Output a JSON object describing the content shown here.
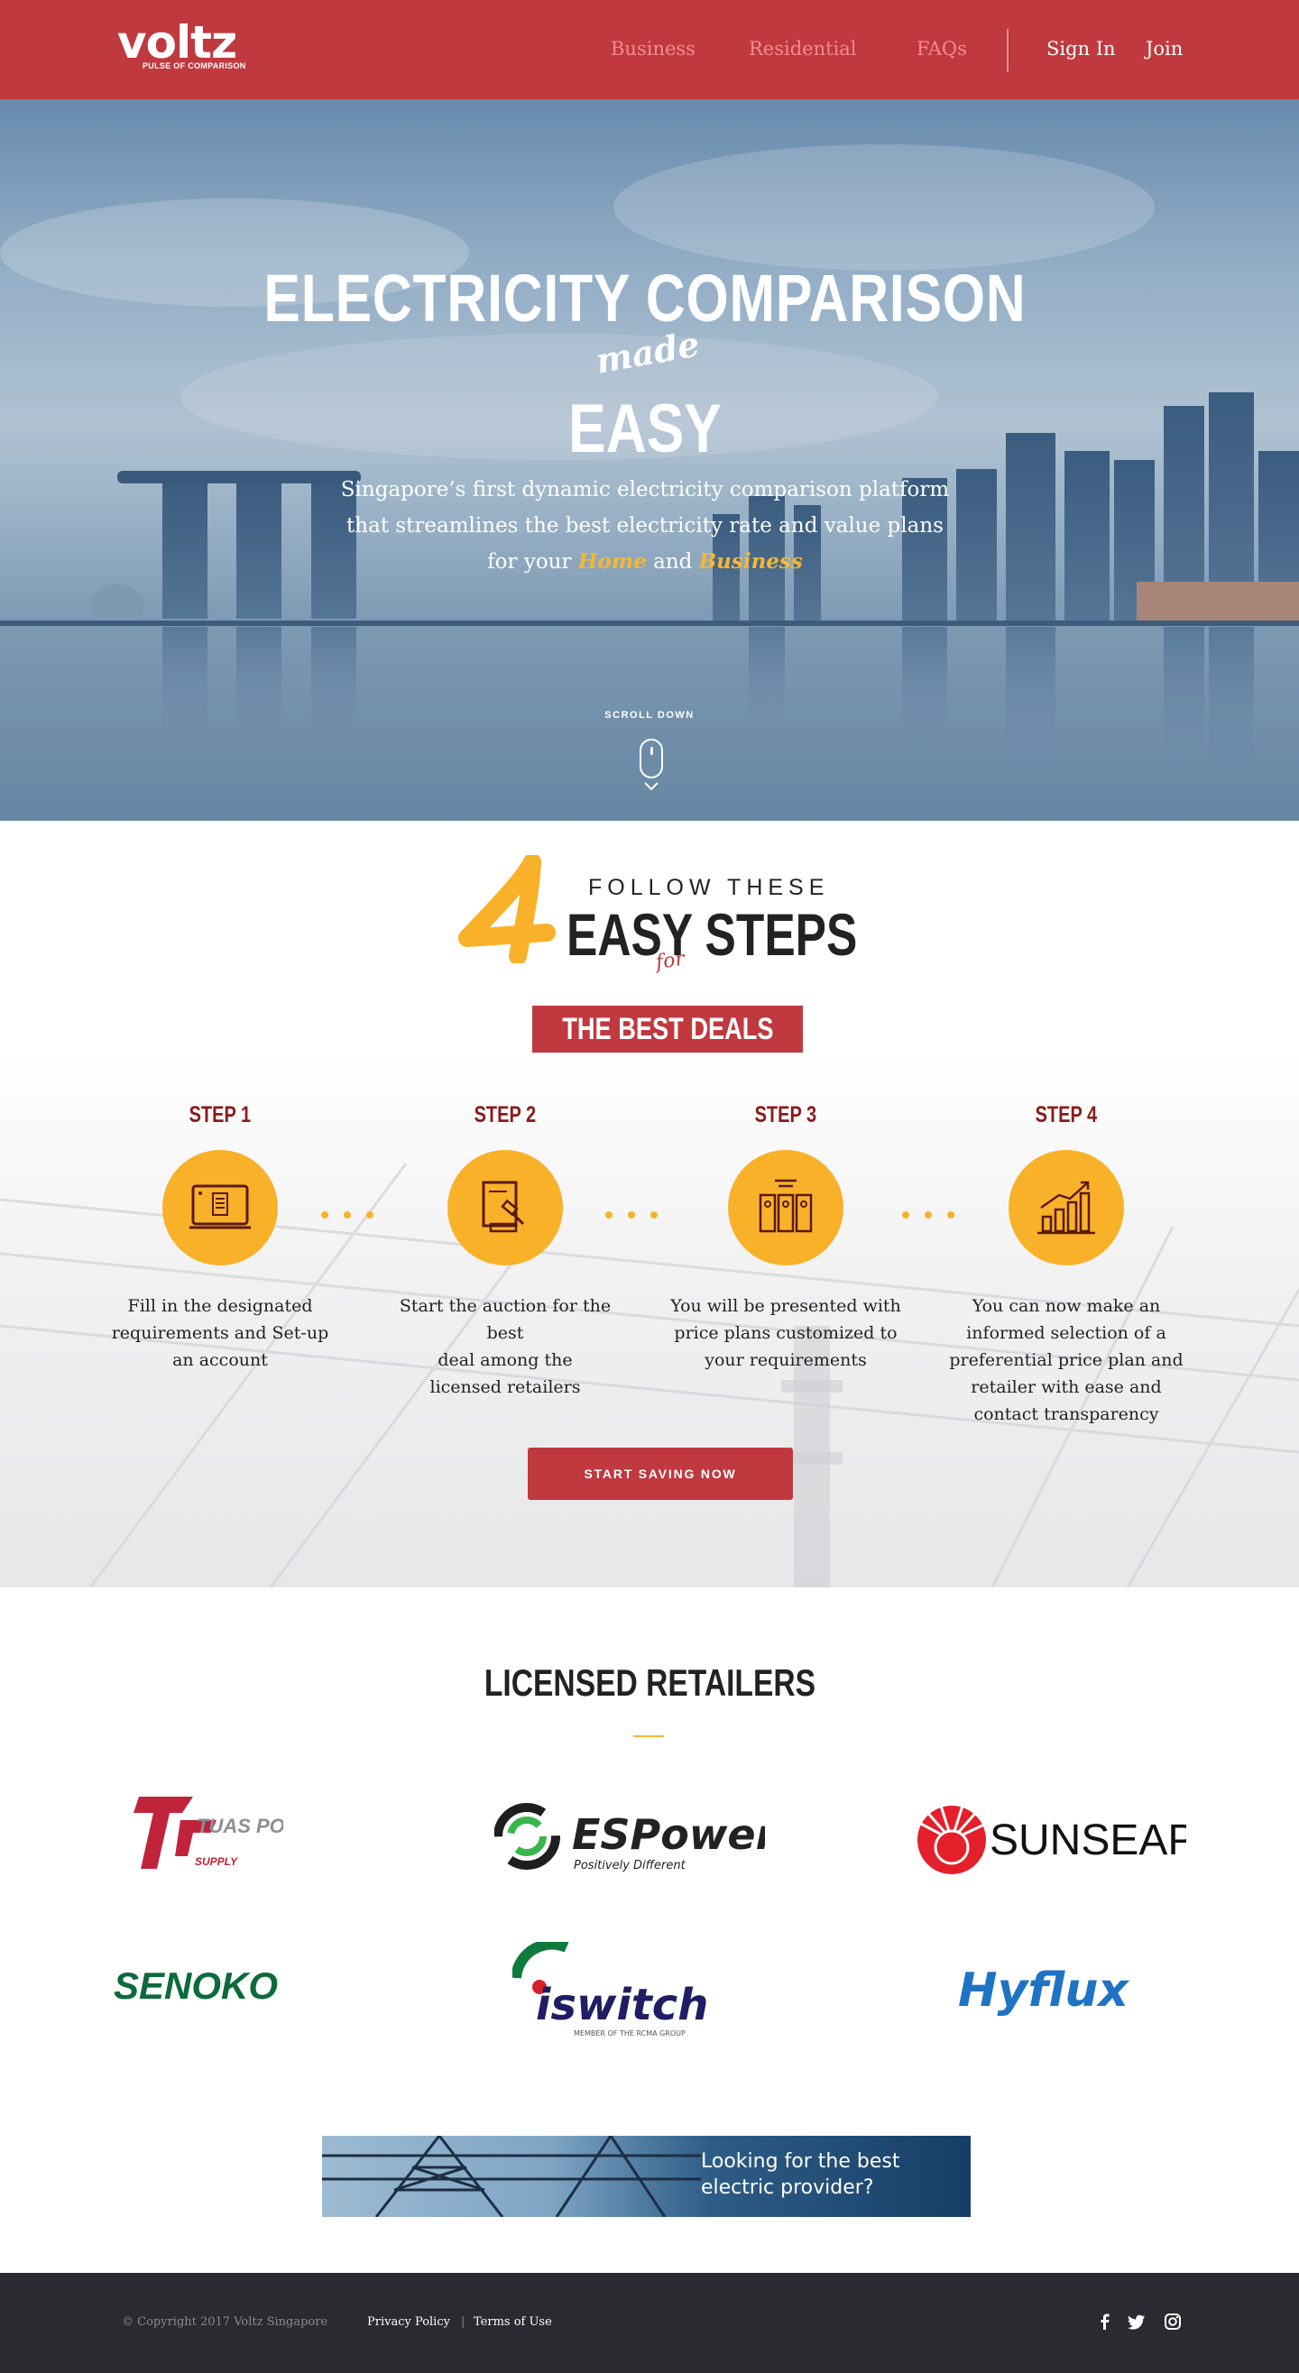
{
  "nav": {
    "logo_word": "voltz",
    "logo_tagline": "PULSE OF COMPARISON",
    "links": [
      {
        "label": "Business"
      },
      {
        "label": "Residential"
      },
      {
        "label": "FAQs"
      }
    ],
    "sign_in": "Sign In",
    "join": "Join"
  },
  "hero": {
    "title": "ELECTRICITY COMPARISON",
    "made": "made",
    "easy": "EASY",
    "subtitle_line1": "Singapore’s first dynamic electricity comparison platform",
    "subtitle_line2": "that streamlines the best electricity rate and value plans",
    "subtitle_prefix": "for your",
    "home": "Home",
    "and": "and",
    "business": "Business",
    "scroll_label": "SCROLL DOWN"
  },
  "steps_section": {
    "big_number": "4",
    "follow": "FOLLOW THESE",
    "easy_steps": "EASY STEPS",
    "for": "for",
    "best_deals": "THE BEST DEALS",
    "steps": [
      {
        "label": "STEP 1",
        "icon": "computer-form-icon",
        "text_lines": [
          "Fill in the designated",
          "requirements and Set-up",
          "an account"
        ]
      },
      {
        "label": "STEP 2",
        "icon": "auction-gavel-icon",
        "text_lines": [
          "Start the auction for the best",
          "deal among the",
          "licensed retailers"
        ]
      },
      {
        "label": "STEP 3",
        "icon": "price-plans-icon",
        "text_lines": [
          "You will be presented with",
          "price plans customized to",
          "your requirements"
        ]
      },
      {
        "label": "STEP 4",
        "icon": "growth-chart-icon",
        "text_lines": [
          "You can now make an",
          "informed selection of a",
          "preferential price plan and",
          "retailer with ease and",
          "contact transparency"
        ]
      }
    ],
    "cta": "START SAVING NOW"
  },
  "retailers": {
    "title": "LICENSED RETAILERS",
    "logos": [
      {
        "name": "TUAS POWER",
        "sub": "SUPPLY",
        "mark": "tuas-power-logo"
      },
      {
        "name": "ESPower",
        "sub": "Positively Different",
        "mark": "espower-logo"
      },
      {
        "name": "SUNSEAP",
        "mark": "sunseap-logo"
      },
      {
        "name": "SENOKO",
        "mark": "senoko-logo"
      },
      {
        "name": "iswitch",
        "sub": "MEMBER OF THE RCMA GROUP",
        "mark": "iswitch-logo"
      },
      {
        "name": "Hyflux",
        "mark": "hyflux-logo"
      }
    ],
    "banner_line1": "Looking for the best",
    "banner_line2": "electric provider?"
  },
  "footer": {
    "copyright": "© Copyright 2017 Voltz Singapore",
    "privacy": "Privacy Policy",
    "separator": "|",
    "terms": "Terms of Use",
    "social": [
      "facebook-icon",
      "twitter-icon",
      "instagram-icon"
    ]
  },
  "colors": {
    "brand_red": "#c0393f",
    "accent_yellow": "#f9b12a",
    "step_red": "#8b1a1a",
    "footer_bg": "#2a2a30"
  }
}
